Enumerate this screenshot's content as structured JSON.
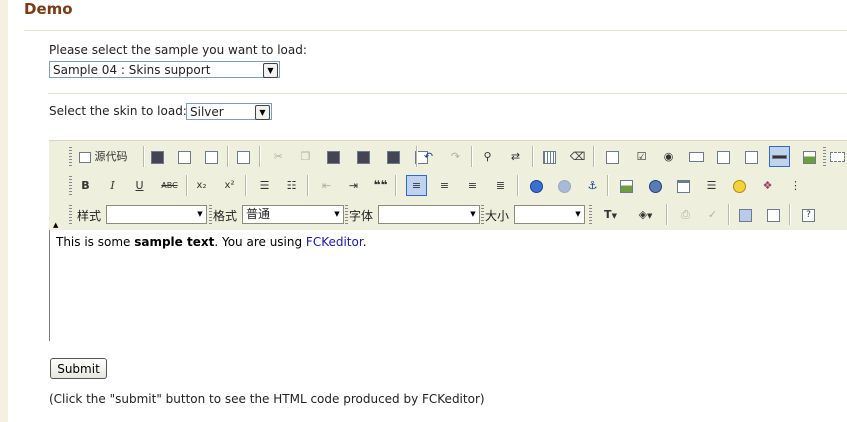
{
  "page": {
    "section_title": "Demo"
  },
  "sample_select": {
    "label": "Please select the sample you want to load:",
    "value": "Sample 04 : Skins support"
  },
  "skin_select": {
    "label": "Select the skin to load:",
    "value": "Silver"
  },
  "toolbar": {
    "source_label": "源代码",
    "style_label": "样式",
    "format_label": "格式",
    "format_value": "普通",
    "font_label": "字体",
    "size_label": "大小",
    "bold": "B",
    "italic": "I",
    "underline": "U",
    "strike": "ABC",
    "subscript": "x₂",
    "superscript": "x²",
    "blockquote": "❝❝"
  },
  "editor": {
    "text_before": "This is some ",
    "text_bold": "sample text",
    "text_middle": ". You are using ",
    "text_link": "FCKeditor",
    "text_end": "."
  },
  "form": {
    "submit_label": "Submit",
    "note": "(Click the \"submit\" button to see the HTML code produced by FCKeditor)"
  }
}
